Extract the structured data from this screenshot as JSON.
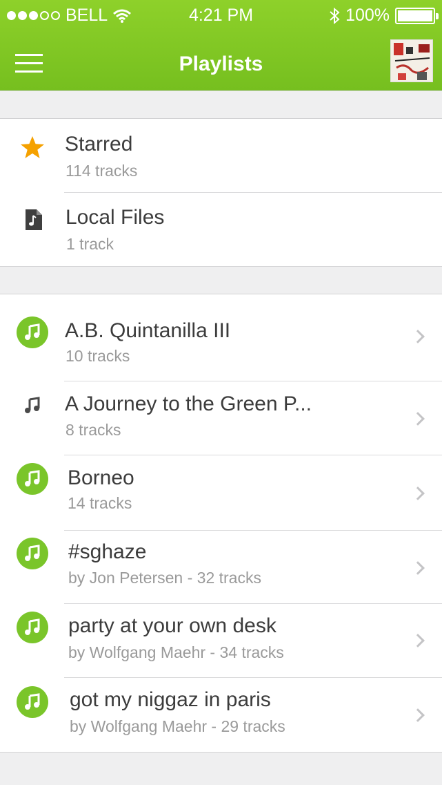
{
  "status_bar": {
    "carrier": "BELL",
    "time": "4:21 PM",
    "battery": "100%"
  },
  "header": {
    "title": "Playlists"
  },
  "special_playlists": [
    {
      "name": "Starred",
      "count": "114 tracks",
      "icon": "star-icon"
    },
    {
      "name": "Local Files",
      "count": "1 track",
      "icon": "music-file-icon"
    }
  ],
  "playlists": [
    {
      "name": "A.B. Quintanilla III",
      "detail": "10 tracks",
      "icon": "music-note-circle-icon"
    },
    {
      "name": "A Journey to the Green P...",
      "detail": "8 tracks",
      "icon": "music-note-icon"
    },
    {
      "name": "Borneo",
      "detail": "14 tracks",
      "icon": "music-note-circle-icon"
    },
    {
      "name": "#sghaze",
      "detail": "by Jon Petersen - 32 tracks",
      "icon": "music-note-circle-icon"
    },
    {
      "name": "party at your own desk",
      "detail": "by Wolfgang Maehr - 34 tracks",
      "icon": "music-note-circle-icon"
    },
    {
      "name": "got my niggaz in paris",
      "detail": "by Wolfgang Maehr - 29 tracks",
      "icon": "music-note-circle-icon"
    }
  ],
  "colors": {
    "header": "#7ec623",
    "accent_green": "#7ac52a",
    "star": "#f5a100"
  }
}
